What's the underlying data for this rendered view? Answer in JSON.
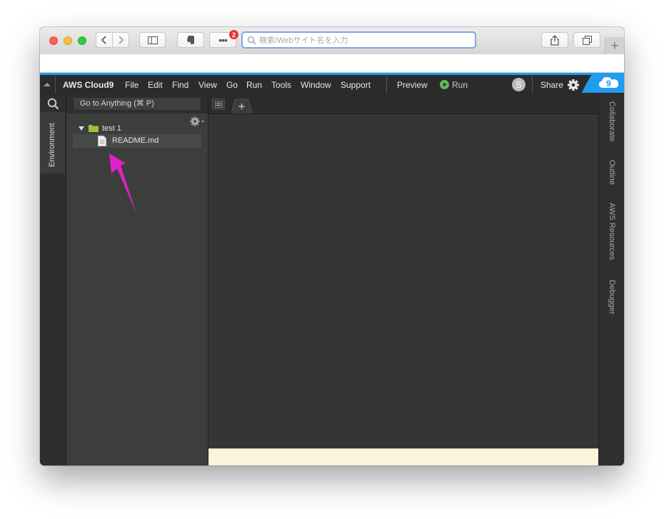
{
  "browser": {
    "address_placeholder": "検索/Webサイト名を入力",
    "extensions_badge": "2",
    "new_tab_label": "+"
  },
  "menubar": {
    "brand": "AWS Cloud9",
    "items": [
      "File",
      "Edit",
      "Find",
      "View",
      "Go",
      "Run",
      "Tools",
      "Window",
      "Support"
    ],
    "preview_label": "Preview",
    "run_label": "Run",
    "avatar_initial": "S",
    "share_label": "Share",
    "accent_color": "#1f9cf0"
  },
  "left_panel": {
    "tab_label": "Environment"
  },
  "sidebar": {
    "goto_label": "Go to Anything (⌘ P)",
    "tree": {
      "folder_name": "test 1",
      "file_name": "README.md"
    },
    "annotation_arrow_color": "#e020c8"
  },
  "right_panel": {
    "tabs": [
      "Collaborate",
      "Outline",
      "AWS Resources",
      "Debugger"
    ]
  }
}
